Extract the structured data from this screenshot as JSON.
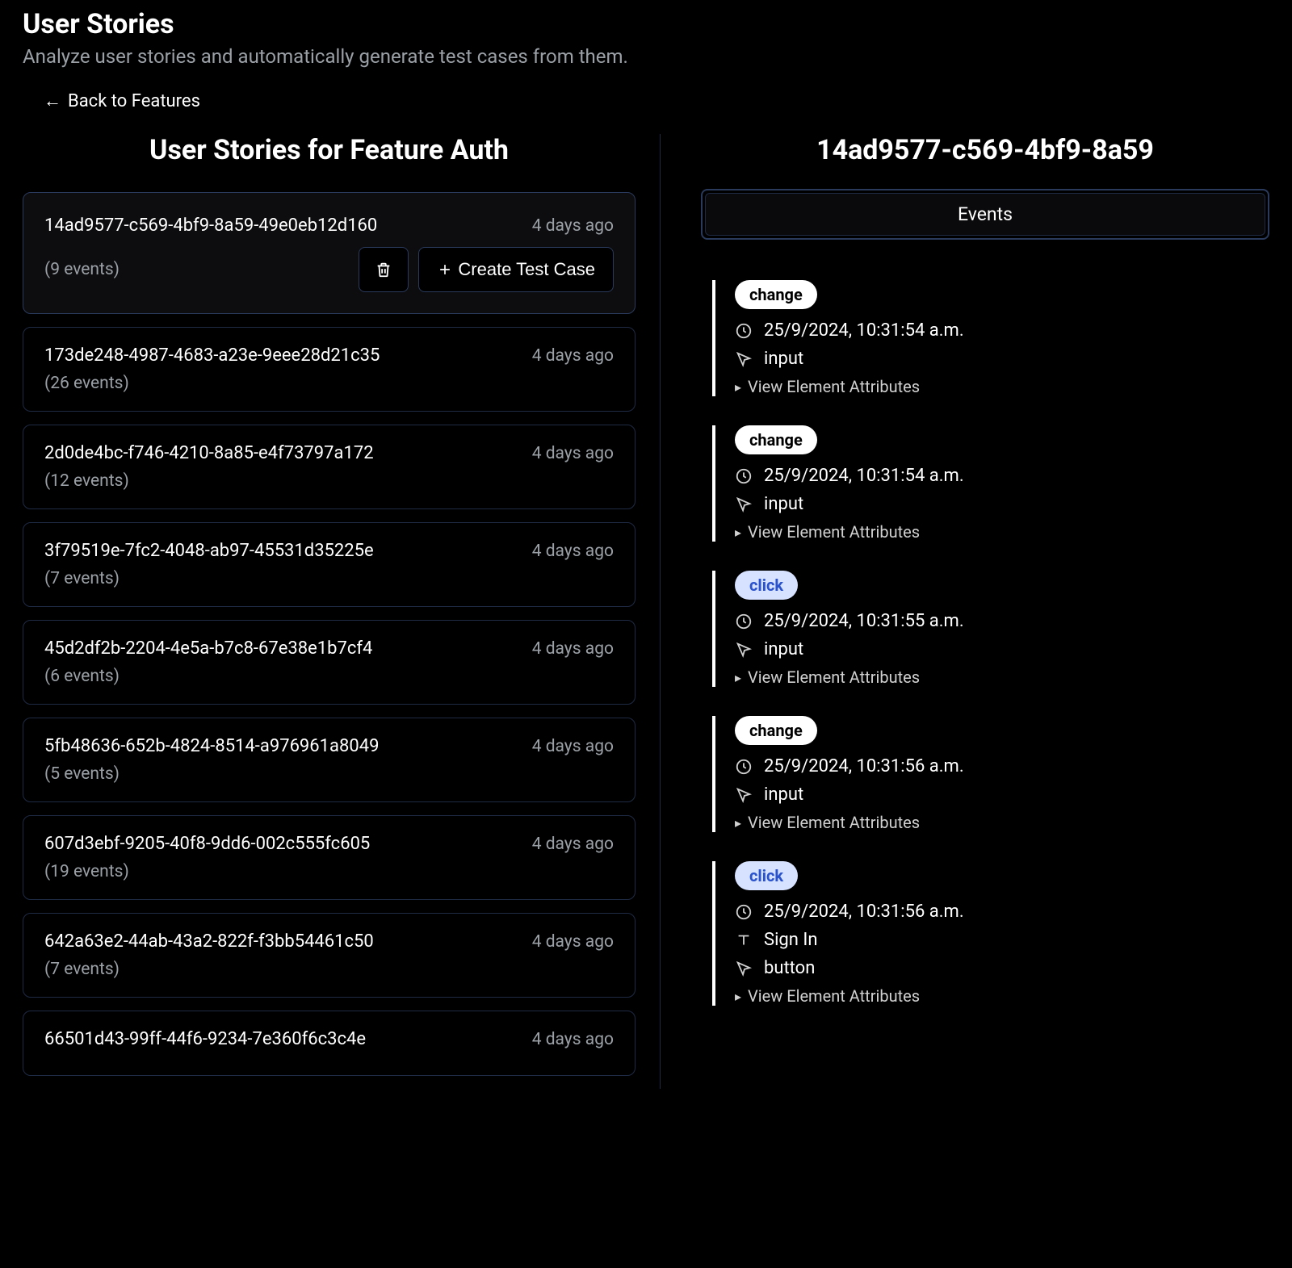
{
  "header": {
    "title": "User Stories",
    "subtitle": "Analyze user stories and automatically generate test cases from them.",
    "back_label": "Back to Features"
  },
  "left": {
    "heading": "User Stories for Feature Auth",
    "delete_label": "Delete",
    "create_label": "Create Test Case",
    "stories": [
      {
        "id": "14ad9577-c569-4bf9-8a59-49e0eb12d160",
        "time": "4 days ago",
        "events": "(9 events)",
        "selected": true
      },
      {
        "id": "173de248-4987-4683-a23e-9eee28d21c35",
        "time": "4 days ago",
        "events": "(26 events)"
      },
      {
        "id": "2d0de4bc-f746-4210-8a85-e4f73797a172",
        "time": "4 days ago",
        "events": "(12 events)"
      },
      {
        "id": "3f79519e-7fc2-4048-ab97-45531d35225e",
        "time": "4 days ago",
        "events": "(7 events)"
      },
      {
        "id": "45d2df2b-2204-4e5a-b7c8-67e38e1b7cf4",
        "time": "4 days ago",
        "events": "(6 events)"
      },
      {
        "id": "5fb48636-652b-4824-8514-a976961a8049",
        "time": "4 days ago",
        "events": "(5 events)"
      },
      {
        "id": "607d3ebf-9205-40f8-9dd6-002c555fc605",
        "time": "4 days ago",
        "events": "(19 events)"
      },
      {
        "id": "642a63e2-44ab-43a2-822f-f3bb54461c50",
        "time": "4 days ago",
        "events": "(7 events)"
      },
      {
        "id": "66501d43-99ff-44f6-9234-7e360f6c3c4e",
        "time": "4 days ago",
        "events": ""
      }
    ]
  },
  "right": {
    "heading": "14ad9577-c569-4bf9-8a59",
    "tab_label": "Events",
    "view_attrs": "View Element Attributes",
    "events": [
      {
        "badge": "change",
        "badge_style": "white",
        "time": "25/9/2024, 10:31:54 a.m.",
        "target": "input"
      },
      {
        "badge": "change",
        "badge_style": "white",
        "time": "25/9/2024, 10:31:54 a.m.",
        "target": "input"
      },
      {
        "badge": "click",
        "badge_style": "blue",
        "time": "25/9/2024, 10:31:55 a.m.",
        "target": "input"
      },
      {
        "badge": "change",
        "badge_style": "white",
        "time": "25/9/2024, 10:31:56 a.m.",
        "target": "input"
      },
      {
        "badge": "click",
        "badge_style": "blue",
        "time": "25/9/2024, 10:31:56 a.m.",
        "text": "Sign In",
        "target": "button"
      }
    ]
  }
}
